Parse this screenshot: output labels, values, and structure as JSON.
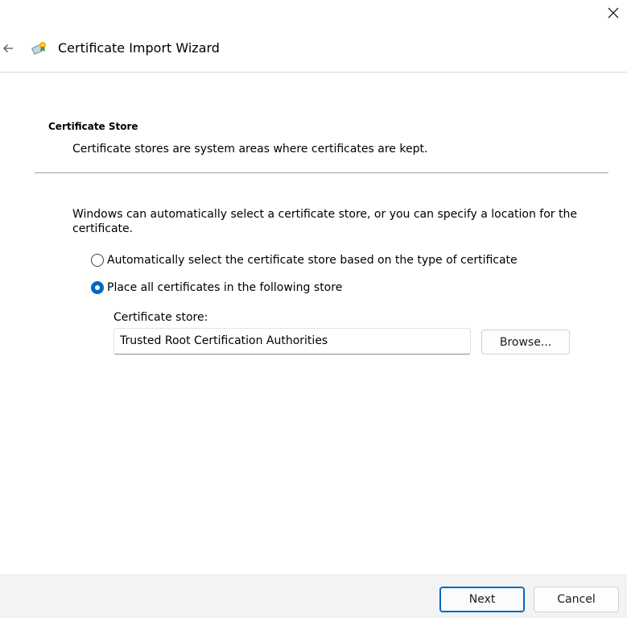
{
  "window": {
    "close_icon": "close-icon",
    "back_icon": "back-arrow-icon",
    "app_icon": "certificate-icon"
  },
  "wizard": {
    "title": "Certificate Import Wizard"
  },
  "section": {
    "heading": "Certificate Store",
    "description": "Certificate stores are system areas where certificates are kept."
  },
  "content": {
    "intro": "Windows can automatically select a certificate store, or you can specify a location for the certificate.",
    "options": [
      {
        "label": "Automatically select the certificate store based on the type of certificate",
        "selected": false
      },
      {
        "label": "Place all certificates in the following store",
        "selected": true
      }
    ],
    "store_label": "Certificate store:",
    "store_value": "Trusted Root Certification Authorities",
    "browse_label": "Browse..."
  },
  "footer": {
    "next_label": "Next",
    "cancel_label": "Cancel"
  },
  "colors": {
    "accent": "#0067c0",
    "footer_bg": "#f3f3f3"
  }
}
